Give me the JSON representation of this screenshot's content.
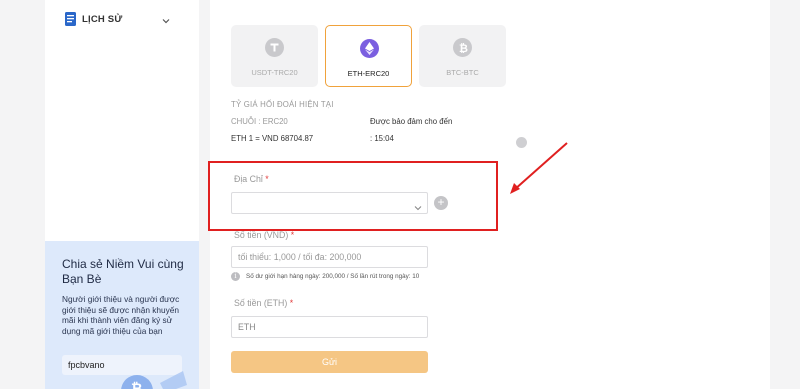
{
  "sidebar": {
    "history_label": "LỊCH SỬ"
  },
  "promo": {
    "title": "Chia sẻ Niềm Vui cùng Bạn Bè",
    "description": "Người giới thiệu và người được giới thiệu sẽ được nhận khuyến mãi khi thành viên đăng ký sử dụng mã giới thiệu của bạn",
    "code": "fpcbvano"
  },
  "currencies": [
    {
      "label": "USDT-TRC20",
      "icon": "tether-icon",
      "active": false
    },
    {
      "label": "ETH-ERC20",
      "icon": "ethereum-icon",
      "active": true
    },
    {
      "label": "BTC-BTC",
      "icon": "bitcoin-icon",
      "active": false
    }
  ],
  "rate": {
    "heading": "TỶ GIÁ HỐI ĐOÁI HIỆN TẠI",
    "chain": "CHUỖI : ERC20",
    "guarantee": "Được bảo đảm cho đến",
    "rate_text": "ETH 1 = VND 68704.87",
    "time": ": 15:04"
  },
  "form": {
    "address_label": "Địa Chỉ",
    "address_value": "",
    "vnd_label": "Số tiền (VND)",
    "vnd_placeholder": "tối thiểu: 1,000 / tối đa: 200,000",
    "limit_info": "Số dư giới hạn hàng ngày: 200,000 / Số lần rút trong ngày: 10",
    "eth_label": "Số tiền (ETH)",
    "eth_placeholder": "ETH",
    "required_mark": "*",
    "submit_label": "Gửi"
  },
  "colors": {
    "accent": "#f0a23b",
    "submit_bg": "#f5c684",
    "annotation_red": "#e02020",
    "promo_bg": "#dde9fb"
  }
}
